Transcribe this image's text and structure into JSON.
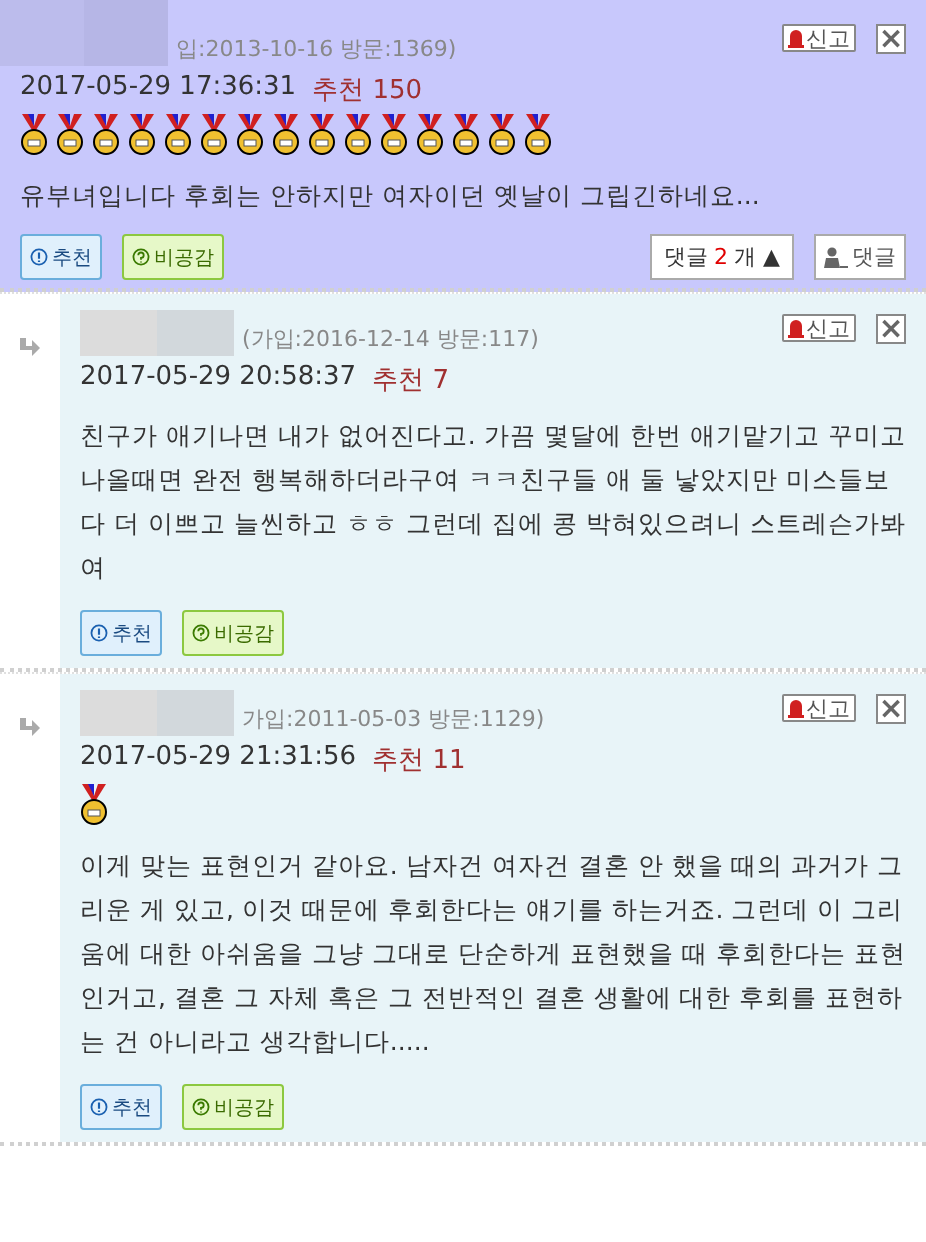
{
  "comments": [
    {
      "kind": "post",
      "member_info": "입:2013-10-16 방문:1369)",
      "datetime": "2017-05-29 17:36:31",
      "recommend_label": "추천",
      "recommend_count": "150",
      "medals": [
        {
          "kind": "medal"
        },
        {
          "kind": "medal"
        },
        {
          "kind": "medal"
        },
        {
          "kind": "medal"
        },
        {
          "kind": "medal"
        },
        {
          "kind": "medal"
        },
        {
          "kind": "medal"
        },
        {
          "kind": "medal"
        },
        {
          "kind": "medal"
        },
        {
          "kind": "medal"
        },
        {
          "kind": "medal"
        },
        {
          "kind": "medal"
        },
        {
          "kind": "medal"
        },
        {
          "kind": "medal"
        },
        {
          "kind": "medal"
        }
      ],
      "body": "유부녀입니다 후회는 안하지만 여자이던 옛날이 그립긴하네요...",
      "report": "신고",
      "close": "×",
      "like_button": "추천",
      "dislike_button": "비공감",
      "reply_toggle": {
        "label": "댓글",
        "count": "2",
        "suffix": "개",
        "caret": "▲"
      },
      "reply_button": "댓글"
    },
    {
      "kind": "reply",
      "member_info": "(가입:2016-12-14 방문:117)",
      "datetime": "2017-05-29 20:58:37",
      "recommend_label": "추천",
      "recommend_count": "7",
      "body": "친구가 애기나면 내가 없어진다고. 가끔 몇달에 한번 애기맡기고 꾸미고 나올때면 완전 행복해하더라구여 ㅋㅋ친구들 애 둘 낳았지만 미스들보다 더 이쁘고 늘씬하고 ㅎㅎ 그런데 집에 콩 박혀있으려니 스트레슨가봐여",
      "report": "신고",
      "close": "×",
      "like_button": "추천",
      "dislike_button": "비공감"
    },
    {
      "kind": "reply",
      "member_info": "가입:2011-05-03 방문:1129)",
      "datetime": "2017-05-29 21:31:56",
      "recommend_label": "추천",
      "recommend_count": "11",
      "medals": [
        {
          "kind": "medal"
        }
      ],
      "body": "이게 맞는 표현인거 같아요. 남자건 여자건 결혼 안 했을 때의 과거가 그리운 게 있고, 이것 때문에 후회한다는 얘기를 하는거죠. 그런데 이 그리움에 대한 아쉬움을 그냥 그대로 단순하게 표현했을 때 후회한다는 표현인거고, 결혼 그 자체 혹은 그 전반적인 결혼 생활에 대한 후회를 표현하는 건 아니라고 생각합니다.....",
      "report": "신고",
      "close": "×",
      "like_button": "추천",
      "dislike_button": "비공감"
    }
  ]
}
